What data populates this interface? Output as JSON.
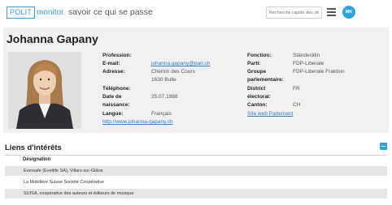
{
  "header": {
    "logo_box": "POLIT",
    "logo_word": "monitor",
    "tagline": "savoir ce qui se passe",
    "search_placeholder": "Recherche rapide des obj",
    "avatar_initials": "MK"
  },
  "profile": {
    "name": "Johanna Gapany",
    "profession_label": "Profession:",
    "email_label": "E-mail:",
    "email_value": "johanna.gapany@parl.ch",
    "address_label": "Adresse:",
    "address_line1": "Chemin des Cours",
    "address_line2": "1630 Bulle",
    "phone_label": "Téléphone:",
    "dob_label1": "Date de",
    "dob_label2": "naissance:",
    "dob_value": "25.07.1988",
    "language_label": "Langue:",
    "language_value": "Français",
    "website": "http://www.johanna-gapany.ch",
    "function_label": "Fonction:",
    "function_value": "Ständerätin",
    "party_label": "Parti:",
    "party_value": "FDP-Liberale",
    "group_label1": "Groupe",
    "group_label2": "parlementaire:",
    "group_value": "FDP-Liberale Fraktion",
    "district_label1": "District",
    "district_label2": "électoral:",
    "district_value": "FR",
    "canton_label": "Canton:",
    "canton_value": "CH",
    "parliament_link": "Site web Parlement"
  },
  "interests": {
    "title": "Liens d'intérêts",
    "column_header": "Désignation",
    "rows": [
      "Eversafe (Eveltife SA), Villars-sur-Glâne",
      "La Mobilière Suisse Société Coopérative",
      "SUISA, coopérative des auteurs et éditeurs de musique"
    ]
  }
}
